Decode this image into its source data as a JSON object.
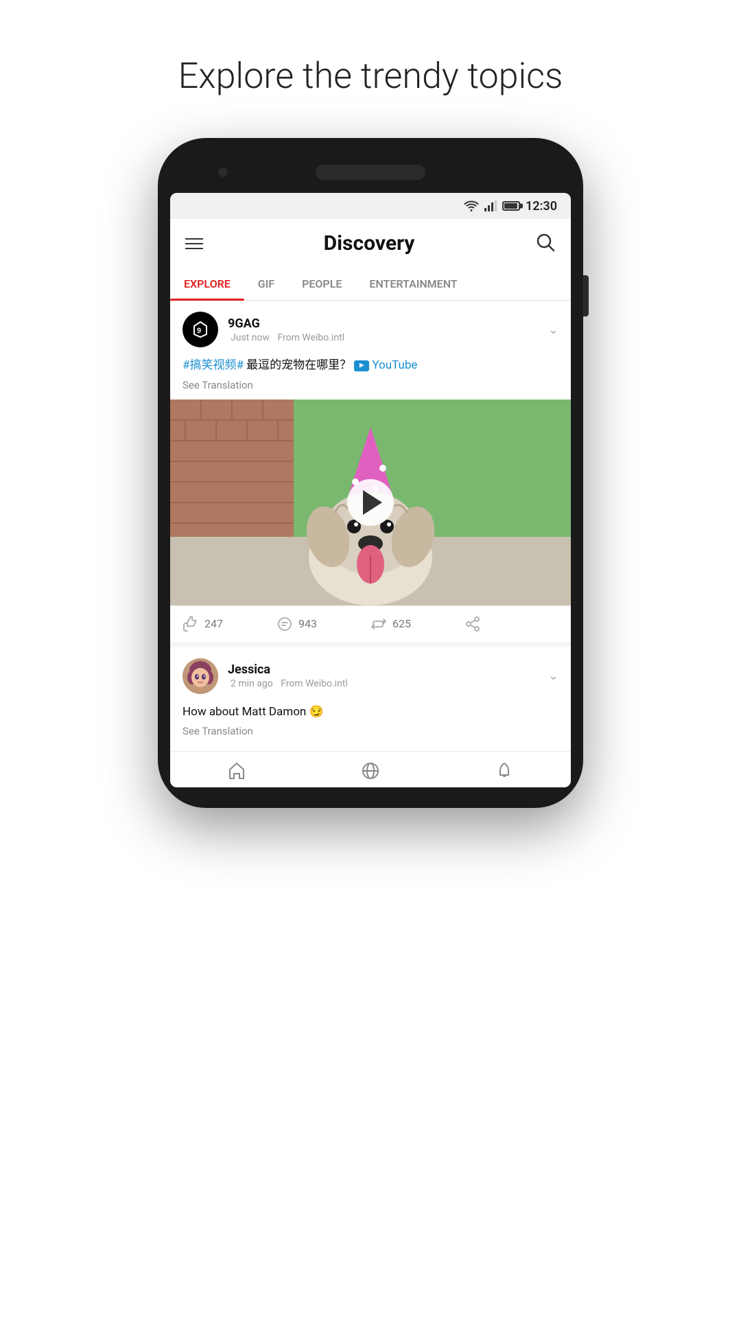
{
  "page": {
    "heading": "Explore the trendy topics"
  },
  "statusBar": {
    "time": "12:30"
  },
  "header": {
    "title": "Discovery",
    "hamburgerLabel": "Menu",
    "searchLabel": "Search"
  },
  "tabs": [
    {
      "id": "explore",
      "label": "EXPLORE",
      "active": true
    },
    {
      "id": "gif",
      "label": "GIF",
      "active": false
    },
    {
      "id": "people",
      "label": "PEOPLE",
      "active": false
    },
    {
      "id": "entertainment",
      "label": "ENTERTAINMENT",
      "active": false
    }
  ],
  "posts": [
    {
      "id": "post-9gag",
      "author": "9GAG",
      "timeAgo": "Just now",
      "source": "From Weibo.intl",
      "hashtag": "#搞笑视频#",
      "bodyText": " 最逗的宠物在哪里？",
      "youtubeLink": "YouTube",
      "seeTranslation": "See Translation",
      "videoAlt": "Dog wearing party hat",
      "likes": "247",
      "comments": "943",
      "reposts": "625"
    },
    {
      "id": "post-jessica",
      "author": "Jessica",
      "timeAgo": "2 min ago",
      "source": "From Weibo.intl",
      "bodyText": "How about Matt Damon 😏",
      "seeTranslation": "See Translation"
    }
  ],
  "bottomNav": {
    "homeLabel": "Home",
    "discoverLabel": "Discover",
    "notificationsLabel": "Notifications"
  },
  "colors": {
    "activeTab": "#e02020",
    "hashtagColor": "#1a8fd1",
    "youtubeColor": "#1a8fd1"
  }
}
